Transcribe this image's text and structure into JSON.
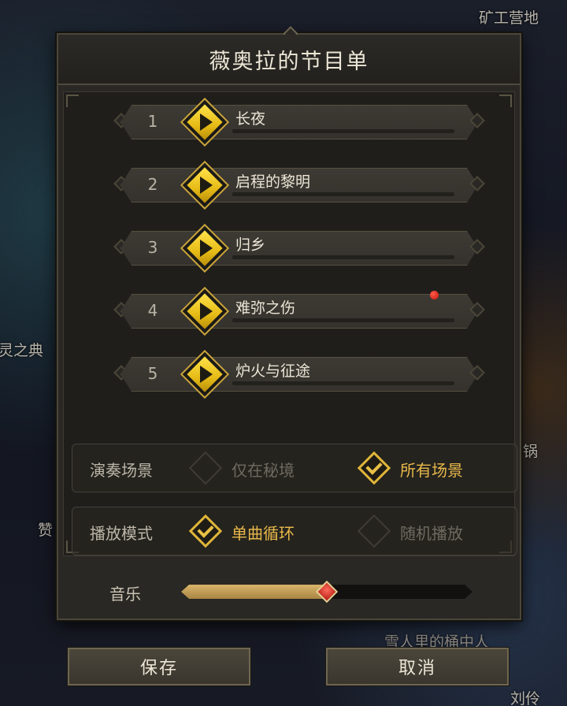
{
  "background": {
    "top_right_label": "矿工营地",
    "left_label": "灵之典",
    "right_label_1": "锅",
    "left_label_2": "赞",
    "bottom_label": "雪人里的桶中人",
    "bottom_right_label": "刘伶"
  },
  "panel": {
    "title": "薇奥拉的节目单"
  },
  "songs": [
    {
      "number": "1",
      "title": "长夜"
    },
    {
      "number": "2",
      "title": "启程的黎明"
    },
    {
      "number": "3",
      "title": "归乡"
    },
    {
      "number": "4",
      "title": "难弥之伤"
    },
    {
      "number": "5",
      "title": "炉火与征途"
    }
  ],
  "options": {
    "scene": {
      "label": "演奏场景",
      "choices": [
        {
          "text": "仅在秘境",
          "selected": false
        },
        {
          "text": "所有场景",
          "selected": true
        }
      ]
    },
    "mode": {
      "label": "播放模式",
      "choices": [
        {
          "text": "单曲循环",
          "selected": true
        },
        {
          "text": "随机播放",
          "selected": false
        }
      ]
    }
  },
  "volume": {
    "label": "音乐",
    "level_fraction": 0.5
  },
  "buttons": {
    "save": "保存",
    "cancel": "取消"
  },
  "colors": {
    "accent_gold": "#e9b84a",
    "play_yellow": "#ffe24a",
    "notification_red": "#d8261c"
  },
  "icons": {
    "play": "play-icon",
    "check": "check-icon"
  }
}
